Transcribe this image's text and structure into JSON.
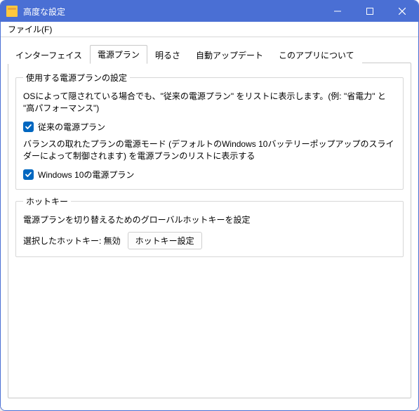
{
  "window": {
    "title": "高度な設定"
  },
  "menubar": {
    "file": "ファイル(F)"
  },
  "tabs": {
    "interface": "インターフェイス",
    "power_plan": "電源プラン",
    "brightness": "明るさ",
    "auto_update": "自動アップデート",
    "about": "このアプリについて"
  },
  "group_power": {
    "legend": "使用する電源プランの設定",
    "desc1": "OSによって隠されている場合でも、\"従来の電源プラン\" をリストに表示します。(例: \"省電力\" と \"高パフォーマンス\")",
    "check1_label": "従来の電源プラン",
    "desc2": "バランスの取れたプランの電源モード (デフォルトのWindows 10バッテリーポップアップのスライダーによって制御されます) を電源プランのリストに表示する",
    "check2_label": "Windows 10の電源プラン"
  },
  "group_hotkey": {
    "legend": "ホットキー",
    "desc": "電源プランを切り替えるためのグローバルホットキーを設定",
    "selected_label": "選択したホットキー: 無効",
    "button": "ホットキー設定"
  }
}
